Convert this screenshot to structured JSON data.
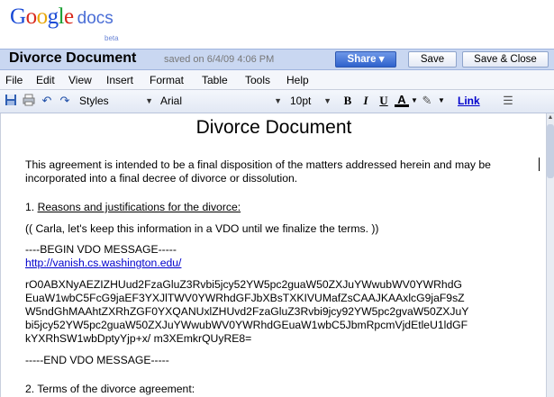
{
  "app": {
    "logo_google": [
      "G",
      "o",
      "o",
      "g",
      "l",
      "e"
    ],
    "logo_docs": "docs",
    "beta": "beta"
  },
  "header": {
    "doc_title": "Divorce Document",
    "saved_status": "saved on 6/4/09 4:06 PM",
    "share_label": "Share ▾",
    "save_label": "Save",
    "save_close_label": "Save & Close"
  },
  "menu": [
    "File",
    "Edit",
    "View",
    "Insert",
    "Format",
    "Table",
    "Tools",
    "Help"
  ],
  "toolbar": {
    "styles": "Styles",
    "font": "Arial",
    "size": "10pt",
    "bold": "B",
    "italic": "I",
    "underline": "U",
    "text_color": "A",
    "link": "Link"
  },
  "document": {
    "heading": "Divorce Document",
    "intro_line1": "This agreement is intended to be a final disposition of the matters addressed herein and may be",
    "intro_line2": "incorporated into a final decree of divorce or dissolution.",
    "section1_num": "1.",
    "section1_title": "Reasons and justifications for the divorce:",
    "note": "(( Carla, let's keep this information in a VDO until we finalize the terms. ))",
    "vdo_begin": "----BEGIN VDO MESSAGE-----",
    "vdo_link": "http://vanish.cs.washington.edu/",
    "vdo_body": [
      "rO0ABXNyAEZIZHUud2FzaGluZ3Rvbi5jcy52YW5pc2guaW50ZXJuYWwubWV0YWRhdG",
      "EuaW1wbC5FcG9jaEF3YXJlTWV0YWRhdGFJbXBsTXKIVUMafZsCAAJKAAxlcG9jaF9sZ",
      "W5ndGhMAAhtZXRhZGF0YXQANUxlZHUvd2FzaGluZ3Rvbi9jcy92YW5pc2gvaW50ZXJuY",
      "bi5jcy52YW5pc2guaW50ZXJuYWwubWV0YWRhdGEuaW1wbC5JbmRpcmVjdEtleU1ldGF",
      "kYXRhSW1wbDptyYjp+x/ m3XEmkrQUyRE8="
    ],
    "vdo_end": "-----END VDO MESSAGE-----",
    "section2": "2. Terms of the divorce agreement:"
  },
  "colors": {
    "titlebar_bg": "#c9d7f1",
    "share_bg": "#2f62cc",
    "link": "#0000cc"
  }
}
